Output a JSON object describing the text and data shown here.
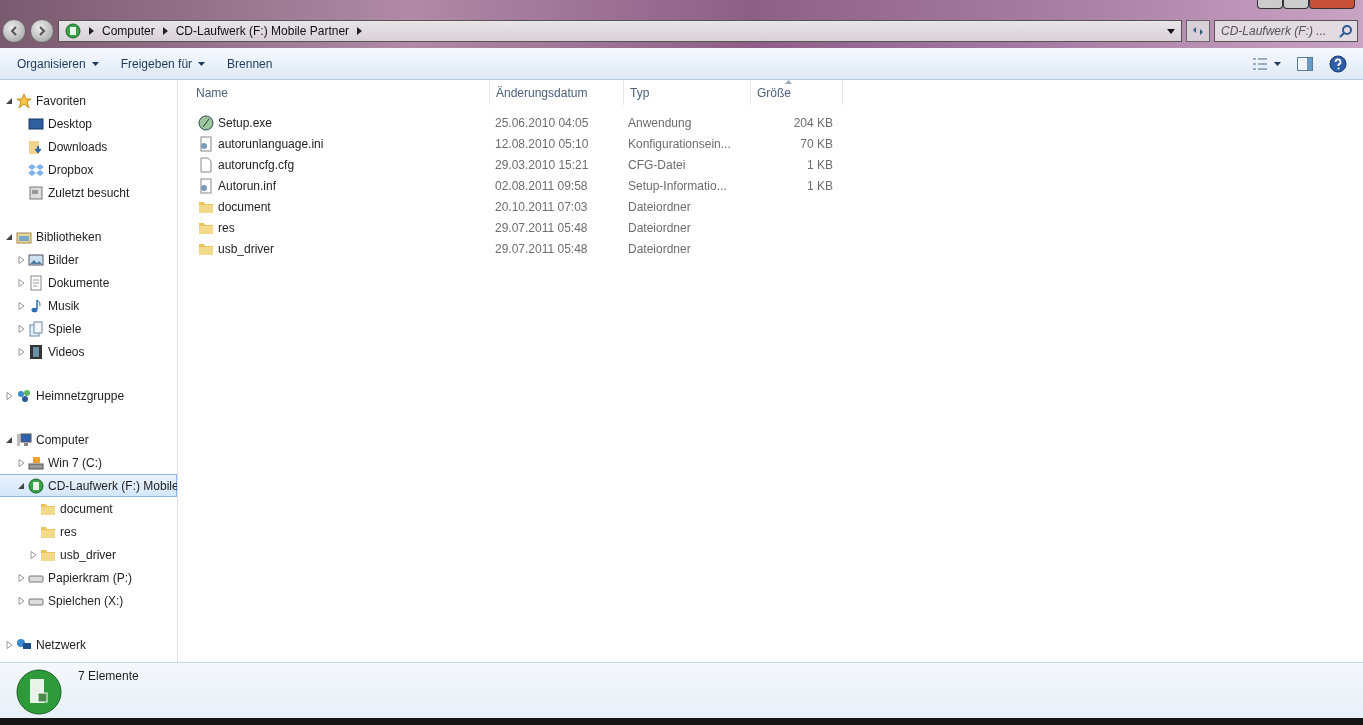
{
  "address_bar": {
    "crumbs": [
      "Computer",
      "CD-Laufwerk (F:) Mobile Partner"
    ]
  },
  "search": {
    "placeholder": "CD-Laufwerk (F:) ..."
  },
  "toolbar": {
    "buttons": [
      {
        "label": "Organisieren",
        "dropdown": true
      },
      {
        "label": "Freigeben für",
        "dropdown": true
      },
      {
        "label": "Brennen",
        "dropdown": false
      }
    ]
  },
  "sidebar": {
    "groups": [
      {
        "label": "Favoriten",
        "kind": "star",
        "expanded": true,
        "selected": false,
        "children": [
          {
            "label": "Desktop",
            "kind": "desktop",
            "selected": false
          },
          {
            "label": "Downloads",
            "kind": "downloads",
            "selected": false
          },
          {
            "label": "Dropbox",
            "kind": "dropbox",
            "selected": false
          },
          {
            "label": "Zuletzt besucht",
            "kind": "recent",
            "selected": false
          }
        ]
      },
      {
        "label": "Bibliotheken",
        "kind": "library",
        "expanded": true,
        "selected": false,
        "children": [
          {
            "label": "Bilder",
            "kind": "pictures",
            "expanded": false,
            "selected": false
          },
          {
            "label": "Dokumente",
            "kind": "documents",
            "expanded": false,
            "selected": false
          },
          {
            "label": "Musik",
            "kind": "music",
            "expanded": false,
            "selected": false
          },
          {
            "label": "Spiele",
            "kind": "games",
            "expanded": false,
            "selected": false
          },
          {
            "label": "Videos",
            "kind": "videos",
            "expanded": false,
            "selected": false
          }
        ]
      },
      {
        "label": "Heimnetzgruppe",
        "kind": "homegroup",
        "expanded": false,
        "selected": false
      },
      {
        "label": "Computer",
        "kind": "computer",
        "expanded": true,
        "selected": false,
        "children": [
          {
            "label": "Win 7 (C:)",
            "kind": "system-drive",
            "expanded": false,
            "selected": false
          },
          {
            "label": "CD-Laufwerk (F:) Mobile",
            "kind": "cd",
            "expanded": true,
            "selected": true,
            "children": [
              {
                "label": "document",
                "kind": "folder",
                "selected": false
              },
              {
                "label": "res",
                "kind": "folder",
                "selected": false
              },
              {
                "label": "usb_driver",
                "kind": "folder",
                "expanded": false,
                "selected": false
              }
            ]
          },
          {
            "label": "Papierkram (P:)",
            "kind": "drive",
            "expanded": false,
            "selected": false
          },
          {
            "label": "Spielchen (X:)",
            "kind": "drive",
            "expanded": false,
            "selected": false
          }
        ]
      },
      {
        "label": "Netzwerk",
        "kind": "network",
        "expanded": false,
        "selected": false
      }
    ]
  },
  "table": {
    "columns": [
      {
        "label": "Name",
        "sorted": false
      },
      {
        "label": "Änderungsdatum",
        "sorted": false
      },
      {
        "label": "Typ",
        "sorted": false
      },
      {
        "label": "Größe",
        "sorted": true
      }
    ],
    "rows": [
      {
        "name": "Setup.exe",
        "kind": "app",
        "date": "25.06.2010 04:05",
        "type": "Anwendung",
        "size": "204 KB"
      },
      {
        "name": "autorunlanguage.ini",
        "kind": "config",
        "date": "12.08.2010 05:10",
        "type": "Konfigurationsein...",
        "size": "70 KB"
      },
      {
        "name": "autoruncfg.cfg",
        "kind": "file",
        "date": "29.03.2010 15:21",
        "type": "CFG-Datei",
        "size": "1 KB"
      },
      {
        "name": "Autorun.inf",
        "kind": "config",
        "date": "02.08.2011 09:58",
        "type": "Setup-Informatio...",
        "size": "1 KB"
      },
      {
        "name": "document",
        "kind": "folder",
        "date": "20.10.2011 07:03",
        "type": "Dateiordner",
        "size": ""
      },
      {
        "name": "res",
        "kind": "folder",
        "date": "29.07.2011 05:48",
        "type": "Dateiordner",
        "size": ""
      },
      {
        "name": "usb_driver",
        "kind": "folder",
        "date": "29.07.2011 05:48",
        "type": "Dateiordner",
        "size": ""
      }
    ]
  },
  "status_bar": {
    "count": "7 Elemente"
  }
}
